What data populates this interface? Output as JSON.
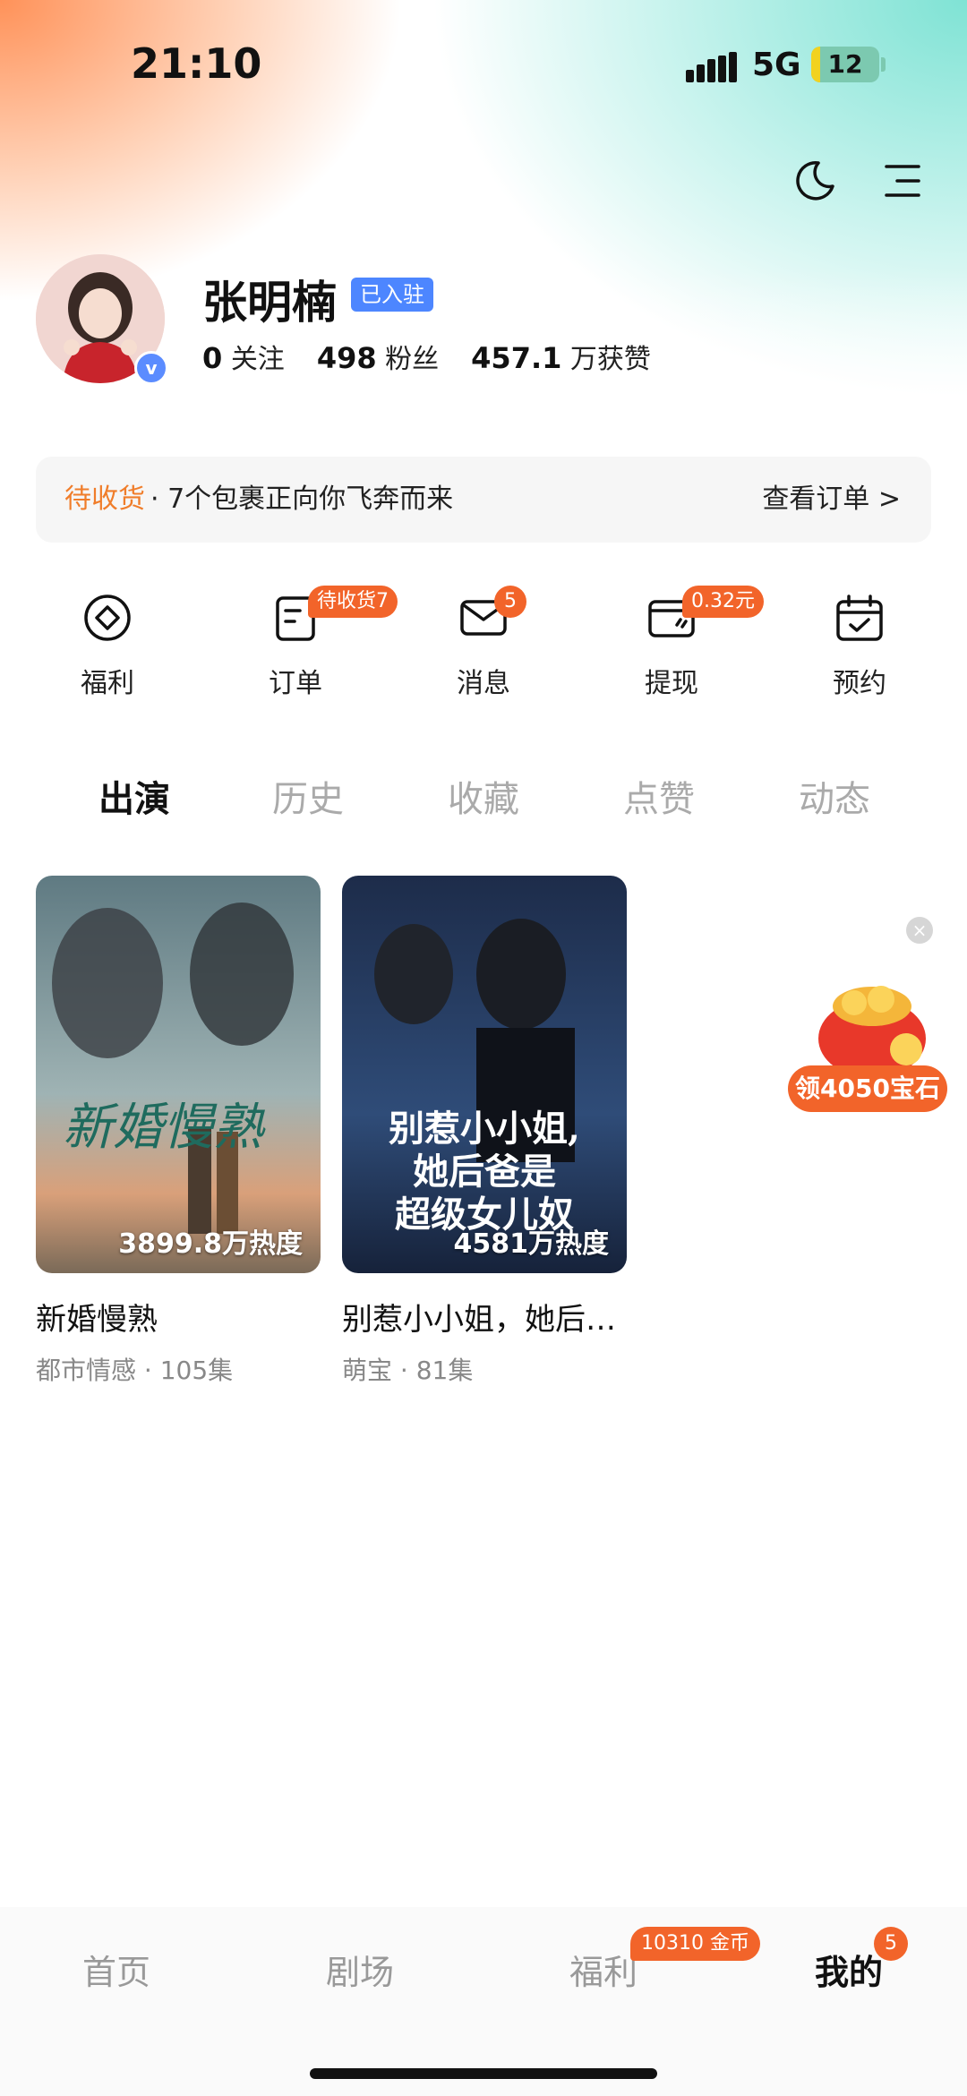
{
  "status_bar": {
    "time": "21:10",
    "network": "5G",
    "battery": "12"
  },
  "profile": {
    "name": "张明楠",
    "tag": "已入驻",
    "avatar_badge": "v",
    "following_count": "0",
    "following_label": "关注",
    "fans_count": "498",
    "fans_label": "粉丝",
    "likes_count": "457.1",
    "likes_label": "万获赞"
  },
  "order_banner": {
    "status": "待收货",
    "text": "· 7个包裹正向你飞奔而来",
    "link": "查看订单 >"
  },
  "quick_actions": [
    {
      "label": "福利",
      "icon": "coin-icon"
    },
    {
      "label": "订单",
      "icon": "order-icon",
      "badge": "待收货7"
    },
    {
      "label": "消息",
      "icon": "message-icon",
      "badge": "5"
    },
    {
      "label": "提现",
      "icon": "wallet-icon",
      "badge": "0.32元"
    },
    {
      "label": "预约",
      "icon": "calendar-icon"
    }
  ],
  "tabs": [
    {
      "label": "出演",
      "active": true
    },
    {
      "label": "历史"
    },
    {
      "label": "收藏"
    },
    {
      "label": "点赞"
    },
    {
      "label": "动态"
    }
  ],
  "cards": [
    {
      "title": "新婚慢熟",
      "meta": "都市情感 · 105集",
      "heat": "3899.8万热度",
      "poster_text": "新婚慢熟"
    },
    {
      "title": "别惹小小姐，她后…",
      "meta": "萌宝 · 81集",
      "heat": "4581万热度",
      "poster_text_1": "别惹小小姐,",
      "poster_text_2": "她后爸是",
      "poster_text_3": "超级女儿奴"
    }
  ],
  "promo": {
    "label": "领4050宝石",
    "close": "×"
  },
  "bottom_nav": [
    {
      "label": "首页"
    },
    {
      "label": "剧场"
    },
    {
      "label": "福利",
      "badge": "10310 金币"
    },
    {
      "label": "我的",
      "badge": "5",
      "active": true
    }
  ],
  "colors": {
    "accent": "#f2642a",
    "tag_blue": "#4d86ff",
    "order_orange": "#f07d2a"
  }
}
